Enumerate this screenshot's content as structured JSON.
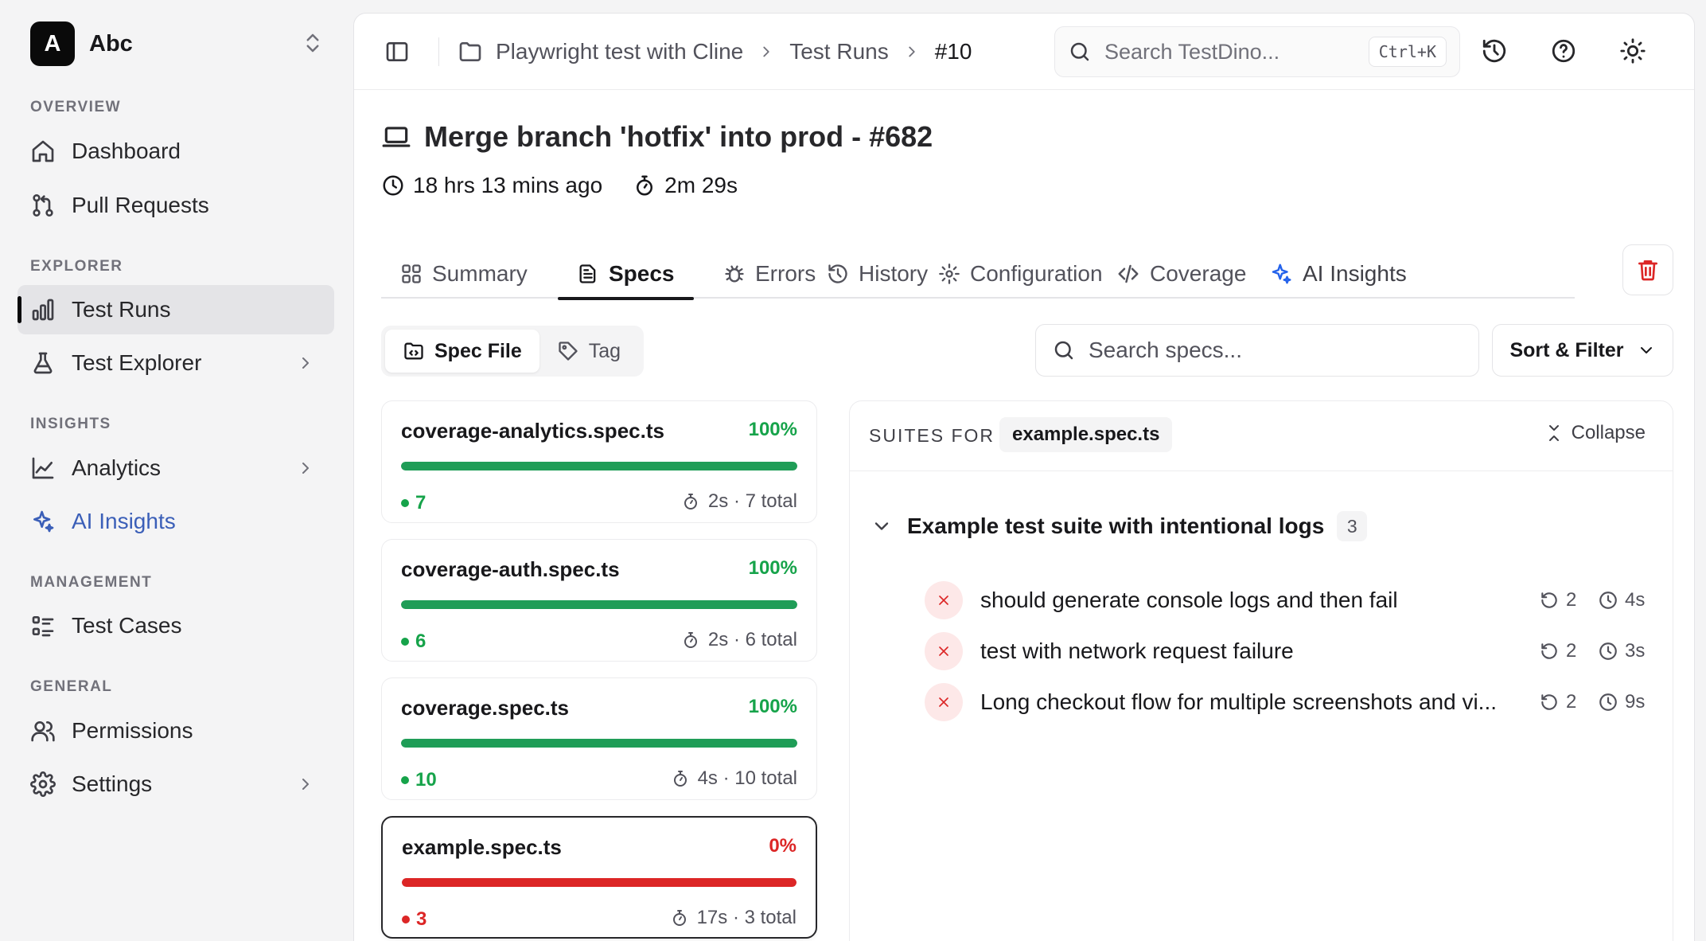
{
  "workspace": {
    "initial": "A",
    "name": "Abc"
  },
  "sidebar": {
    "sections": [
      {
        "label": "OVERVIEW"
      },
      {
        "label": "EXPLORER"
      },
      {
        "label": "INSIGHTS"
      },
      {
        "label": "MANAGEMENT"
      },
      {
        "label": "GENERAL"
      }
    ],
    "items": [
      {
        "label": "Dashboard",
        "icon": "home-icon"
      },
      {
        "label": "Pull Requests",
        "icon": "git-pull-request-icon"
      },
      {
        "label": "Test Runs",
        "icon": "bar-chart-icon",
        "active": true
      },
      {
        "label": "Test Explorer",
        "icon": "flask-icon",
        "has_submenu": true
      },
      {
        "label": "Analytics",
        "icon": "line-chart-icon",
        "has_submenu": true
      },
      {
        "label": "AI Insights",
        "icon": "sparkles-icon"
      },
      {
        "label": "Test Cases",
        "icon": "list-checks-icon"
      },
      {
        "label": "Permissions",
        "icon": "users-icon"
      },
      {
        "label": "Settings",
        "icon": "gear-icon",
        "has_submenu": true
      }
    ]
  },
  "header": {
    "breadcrumbs": [
      "Playwright test with Cline",
      "Test Runs",
      "#10"
    ],
    "search_placeholder": "Search TestDino...",
    "search_shortcut": "Ctrl+K"
  },
  "run": {
    "title": "Merge branch 'hotfix' into prod - #682",
    "time_ago": "18 hrs 13 mins ago",
    "duration": "2m 29s"
  },
  "tabs": [
    {
      "label": "Summary",
      "icon": "grid-icon"
    },
    {
      "label": "Specs",
      "icon": "file-text-icon",
      "active": true
    },
    {
      "label": "Errors",
      "icon": "bug-icon"
    },
    {
      "label": "History",
      "icon": "history-icon"
    },
    {
      "label": "Configuration",
      "icon": "gear-icon"
    },
    {
      "label": "Coverage",
      "icon": "code-icon"
    },
    {
      "label": "AI Insights",
      "icon": "sparkles-icon"
    }
  ],
  "view_toggle": {
    "spec_file": "Spec File",
    "tag": "Tag",
    "active": "spec_file"
  },
  "spec_search_placeholder": "Search specs...",
  "sort_filter_label": "Sort & Filter",
  "specs": [
    {
      "name": "coverage-analytics.spec.ts",
      "pct_label": "100%",
      "pass_rate": 1.0,
      "count": "7",
      "duration": "2s",
      "total": "7 total",
      "status": "pass"
    },
    {
      "name": "coverage-auth.spec.ts",
      "pct_label": "100%",
      "pass_rate": 1.0,
      "count": "6",
      "duration": "2s",
      "total": "6 total",
      "status": "pass"
    },
    {
      "name": "coverage.spec.ts",
      "pct_label": "100%",
      "pass_rate": 1.0,
      "count": "10",
      "duration": "4s",
      "total": "10 total",
      "status": "pass"
    },
    {
      "name": "example.spec.ts",
      "pct_label": "0%",
      "pass_rate": 0.0,
      "count": "3",
      "duration": "17s",
      "total": "3 total",
      "status": "fail",
      "selected": true
    }
  ],
  "suites_panel": {
    "label": "SUITES FOR",
    "spec": "example.spec.ts",
    "collapse_label": "Collapse",
    "suite": {
      "title": "Example test suite with intentional logs",
      "count": "3",
      "tests": [
        {
          "name": "should generate console logs and then fail",
          "retries": "2",
          "duration": "4s",
          "status": "failed"
        },
        {
          "name": "test with network request failure",
          "retries": "2",
          "duration": "3s",
          "status": "failed"
        },
        {
          "name": "Long checkout flow for multiple screenshots and vi...",
          "retries": "2",
          "duration": "9s",
          "status": "failed"
        }
      ]
    }
  },
  "colors": {
    "pass": "#16a34a",
    "pass_bar": "#1f9d57",
    "fail": "#dc2626",
    "ai_accent": "#3b5fb8"
  }
}
